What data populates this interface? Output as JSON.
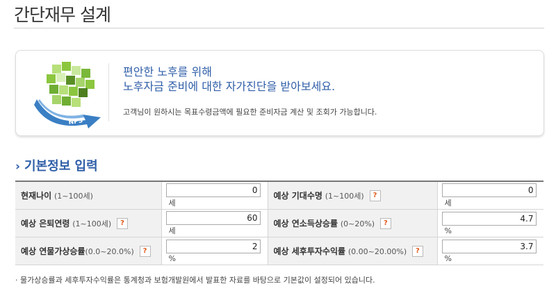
{
  "page": {
    "title": "간단재무 설계"
  },
  "banner": {
    "headline_line1": "편안한 노후를 위해",
    "headline_line2": "노후자금 준비에 대한 자가진단을 받아보세요.",
    "description": "고객님이 원하시는 목표수령금액에 필요한 준비자금 계산 및 조회가 가능합니다.",
    "logo_text": "NPS",
    "colors": {
      "cube_green": "#8cc63f",
      "cube_dark": "#5a8f26",
      "arrow_blue": "#3a7fc4"
    }
  },
  "section": {
    "title": "기본정보 입력",
    "icon": "chevron-right-icon"
  },
  "form": {
    "help_label": "?",
    "fields": {
      "current_age": {
        "label": "현재나이",
        "range": "(1~100세)",
        "value": "0",
        "unit": "세"
      },
      "life_expectancy": {
        "label": "예상 기대수명",
        "range": "(1~100세)",
        "value": "0",
        "unit": "세"
      },
      "retirement_age": {
        "label": "예상 은퇴연령",
        "range": "(1~100세)",
        "value": "60",
        "unit": "세"
      },
      "income_growth": {
        "label": "예상 연소득상승률",
        "range": "(0~20%)",
        "value": "4.7",
        "unit": "%"
      },
      "inflation": {
        "label": "예상 연물가상승률",
        "range": "(0.0~20.0%)",
        "value": "2",
        "unit": "%"
      },
      "after_tax_return": {
        "label": "예상 세후투자수익률",
        "range": "(0.00~20.00%)",
        "value": "3.7",
        "unit": "%"
      }
    }
  },
  "footnote": "· 물가상승률과 세후투자수익률은 통계청과 보험개발원에서 발표한 자료를 바탕으로 기본값이 설정되어 있습니다.",
  "colors": {
    "accent": "#2f5ea8",
    "help_icon": "#e05a1c",
    "label_bg": "#f1f1f1"
  }
}
